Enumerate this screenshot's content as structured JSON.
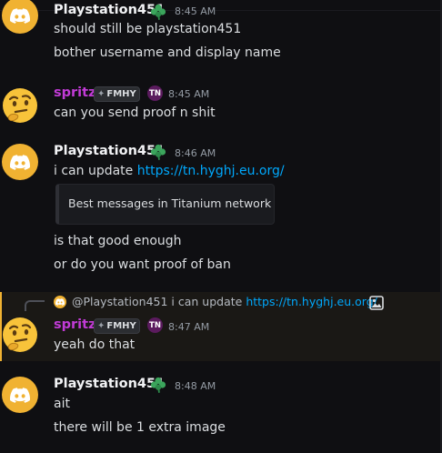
{
  "messages": [
    {
      "author": "Playstation451",
      "time": "8:45 AM",
      "lines": [
        "should still be playstation451",
        "bother username and display name"
      ]
    },
    {
      "author": "spritz",
      "tag": "FMHY",
      "badge": "TN",
      "time": "8:45 AM",
      "lines": [
        "can you send proof n shit"
      ]
    },
    {
      "author": "Playstation451",
      "time": "8:46 AM",
      "text_prefix": "i can update ",
      "link": "https://tn.hyghj.eu.org/",
      "embed_title": "Best messages in Titanium network",
      "lines": [
        "is that good enough",
        "or do you want proof of ban"
      ]
    },
    {
      "reply": {
        "mention": "@Playstation451",
        "text": " i can update ",
        "link": "https://tn.hyghj.eu.org/",
        "icon": "image-icon"
      },
      "author": "spritz",
      "tag": "FMHY",
      "badge": "TN",
      "time": "8:47 AM",
      "lines": [
        "yeah do that"
      ]
    },
    {
      "author": "Playstation451",
      "time": "8:48 AM",
      "lines": [
        "ait",
        "there will be 1 extra image"
      ]
    }
  ],
  "colors": {
    "background": "#0f0f12",
    "discord_avatar": "#f0b232",
    "spritz_name": "#c13bd6",
    "link": "#00a8fc",
    "reply_highlight": "#1a1815"
  }
}
